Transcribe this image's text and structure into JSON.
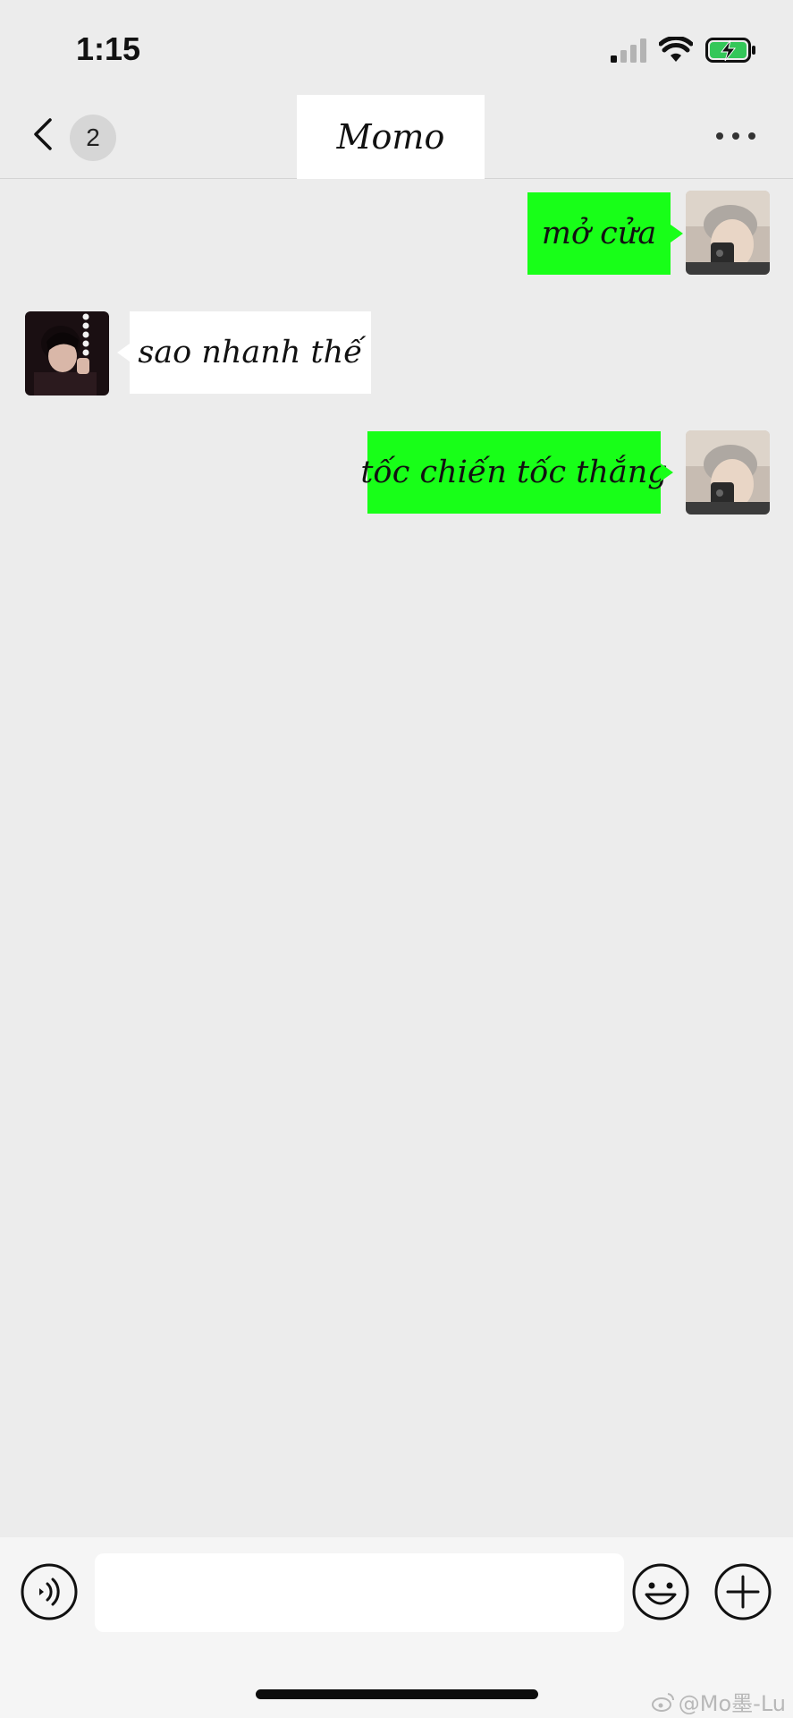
{
  "status_bar": {
    "time": "1:15",
    "icons": [
      "cellular-signal-icon",
      "wifi-icon",
      "battery-charging-icon"
    ]
  },
  "header": {
    "unread_count": "2",
    "title": "Momo",
    "icons": [
      "back-chevron-icon",
      "more-dots-icon"
    ]
  },
  "messages": [
    {
      "direction": "outgoing",
      "text": "mở cửa",
      "avatar": "avatar-me"
    },
    {
      "direction": "incoming",
      "text": "sao nhanh thế",
      "avatar": "avatar-momo"
    },
    {
      "direction": "outgoing",
      "text": "tốc chiến tốc thắng",
      "avatar": "avatar-me"
    }
  ],
  "colors": {
    "outgoing_bubble": "#18ff18",
    "incoming_bubble": "#ffffff",
    "chat_background": "#ececec"
  },
  "input_bar": {
    "value": "",
    "icons": [
      "voice-icon",
      "emoji-icon",
      "plus-icon"
    ]
  },
  "watermark": "@Mo墨-Lu"
}
